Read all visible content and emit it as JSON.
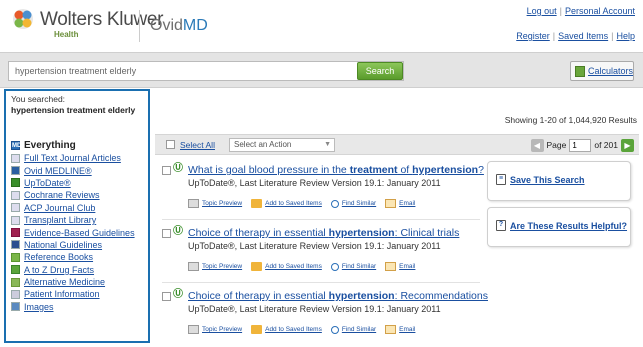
{
  "header": {
    "brand": "Wolters Kluwer",
    "brand_sub": "Health",
    "product_prefix": "Ovid",
    "product_suffix": "MD",
    "links_top": [
      "Log out",
      "Personal Account"
    ],
    "links_bottom": [
      "Register",
      "Saved Items",
      "Help"
    ]
  },
  "search": {
    "value": "hypertension treatment elderly",
    "button": "Search",
    "calculators": "Calculators"
  },
  "sidebar": {
    "you_searched": "You searched:",
    "term": "hypertension treatment elderly",
    "everything": "Everything",
    "items": [
      {
        "label": "Full Text Journal Articles",
        "icon": "document-icon"
      },
      {
        "label": "Ovid MEDLINE®",
        "icon": "medline-icon"
      },
      {
        "label": "UpToDate®",
        "icon": "uptodate-icon"
      },
      {
        "label": "Cochrane Reviews",
        "icon": "document-icon"
      },
      {
        "label": "ACP Journal Club",
        "icon": "document-icon"
      },
      {
        "label": "Transplant Library",
        "icon": "document-icon"
      },
      {
        "label": "Evidence-Based Guidelines",
        "icon": "guidelines-icon"
      },
      {
        "label": "National Guidelines",
        "icon": "national-guidelines-icon"
      },
      {
        "label": "Reference Books",
        "icon": "book-icon"
      },
      {
        "label": "A to Z Drug Facts",
        "icon": "drug-facts-icon"
      },
      {
        "label": "Alternative Medicine",
        "icon": "leaf-icon"
      },
      {
        "label": "Patient Information",
        "icon": "patient-icon"
      },
      {
        "label": "Images",
        "icon": "image-icon"
      }
    ]
  },
  "results": {
    "count": "Showing 1-20 of 1,044,920 Results",
    "select_all": "Select All",
    "action_placeholder": "Select an Action",
    "page_label": "Page",
    "page_value": "1",
    "page_of": "of 201",
    "items": [
      {
        "title_parts": [
          "What is goal blood pressure in the ",
          "treatment",
          " of ",
          "hypertension",
          "?"
        ],
        "meta": "UpToDate®, Last Literature Review Version 19.1: January 2011"
      },
      {
        "title_parts": [
          "Choice of therapy in essential ",
          "hypertension",
          ": Clinical trials",
          "",
          ""
        ],
        "meta": "UpToDate®, Last Literature Review Version 19.1: January 2011"
      },
      {
        "title_parts": [
          "Choice of therapy in essential ",
          "hypertension",
          ": Recommendations",
          "",
          ""
        ],
        "meta": "UpToDate®, Last Literature Review Version 19.1: January 2011"
      }
    ],
    "actions": [
      "Topic Preview",
      "Add to Saved Items",
      "Find Similar",
      "Email"
    ]
  },
  "right": {
    "save_search": "Save This Search",
    "helpful": "Are These Results Helpful?"
  },
  "colors": {
    "accent": "#1a6fb0",
    "link": "#1a4fa0",
    "search_green": "#5a9c2c"
  }
}
